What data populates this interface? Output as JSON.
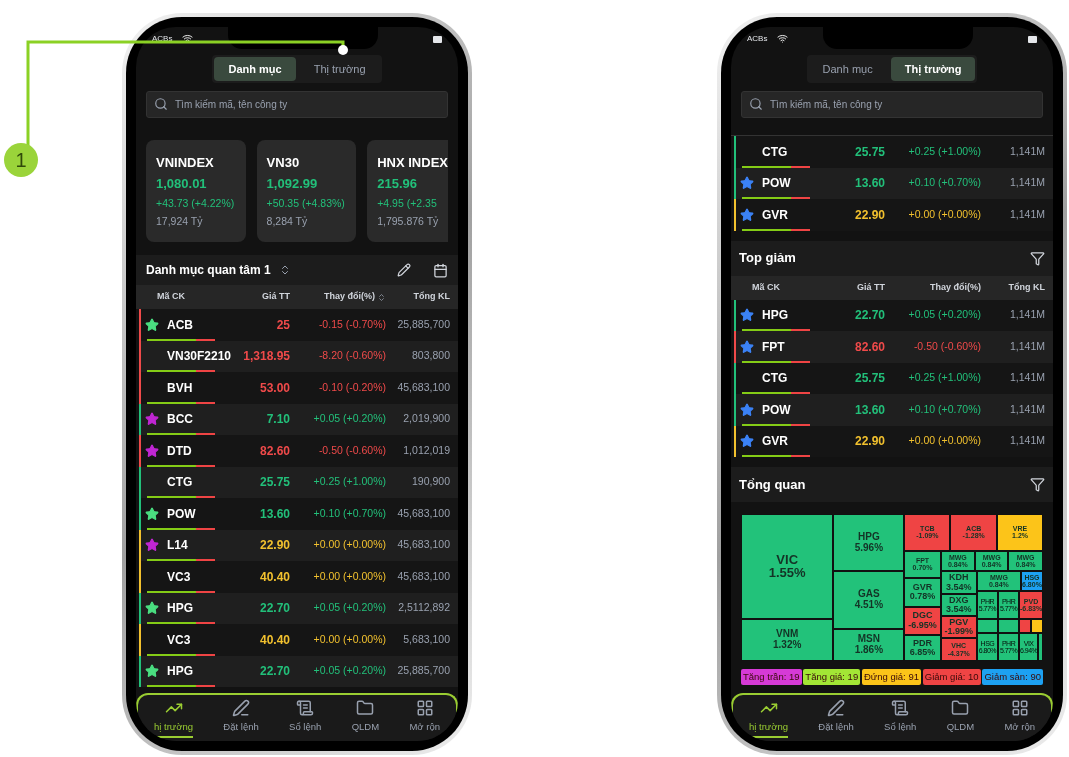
{
  "callout": {
    "label": "1"
  },
  "phones": [
    {
      "kind": "watchlist",
      "status": {
        "carrier": "ACBs"
      },
      "tabs": [
        {
          "label": "Danh mục",
          "selected": true
        },
        {
          "label": "Thị trường",
          "selected": false
        }
      ],
      "search": {
        "placeholder": "Tìm kiếm mã, tên công ty"
      },
      "index_cards": [
        {
          "name": "VNINDEX",
          "value": "1,080.01",
          "change": "+43.73 (+4.22%)",
          "turnover": "17,924 Tỷ",
          "color": "#22c07a"
        },
        {
          "name": "VN30",
          "value": "1,092.99",
          "change": "+50.35 (+4.83%)",
          "turnover": "8,284 Tỷ",
          "color": "#22c07a"
        },
        {
          "name": "HNX INDEX",
          "value": "215.96",
          "change": "+4.95 (+2.35",
          "turnover": "1,795.876 Tỷ",
          "color": "#22c07a"
        }
      ],
      "watchlist": {
        "title": "Danh mục quan tâm 1",
        "columns": [
          {
            "label": "Mã CK",
            "sortable": false
          },
          {
            "label": "Giá TT",
            "sortable": false
          },
          {
            "label": "Thay đổi(%)",
            "sortable": true
          },
          {
            "label": "Tổng KL",
            "sortable": false
          }
        ],
        "rows": [
          {
            "symbol": "ACB",
            "price": "25",
            "change": "-0.15 (-0.70%)",
            "volume": "25,885,700",
            "color": "#f04a4a",
            "star": {
              "color": "#4ade80"
            }
          },
          {
            "symbol": "VN30F2210",
            "price": "1,318.95",
            "change": "-8.20 (-0.60%)",
            "volume": "803,800",
            "color": "#f04a4a"
          },
          {
            "symbol": "BVH",
            "price": "53.00",
            "change": "-0.10 (-0.20%)",
            "volume": "45,683,100",
            "color": "#f04a4a"
          },
          {
            "symbol": "BCC",
            "price": "7.10",
            "change": "+0.05 (+0.20%)",
            "volume": "2,019,900",
            "color": "#22c07a",
            "star": {
              "color": "#c026d3"
            }
          },
          {
            "symbol": "DTD",
            "price": "82.60",
            "change": "-0.50 (-0.60%)",
            "volume": "1,012,019",
            "color": "#f04a4a",
            "star": {
              "color": "#c026d3"
            }
          },
          {
            "symbol": "CTG",
            "price": "25.75",
            "change": "+0.25 (+1.00%)",
            "volume": "190,900",
            "color": "#22c07a"
          },
          {
            "symbol": "POW",
            "price": "13.60",
            "change": "+0.10 (+0.70%)",
            "volume": "45,683,100",
            "color": "#22c07a",
            "star": {
              "color": "#4ade80"
            }
          },
          {
            "symbol": "L14",
            "price": "22.90",
            "change": "+0.00 (+0.00%)",
            "volume": "45,683,100",
            "color": "#f2c12e",
            "star": {
              "color": "#c026d3"
            }
          },
          {
            "symbol": "VC3",
            "price": "40.40",
            "change": "+0.00 (+0.00%)",
            "volume": "45,683,100",
            "color": "#f2c12e"
          },
          {
            "symbol": "HPG",
            "price": "22.70",
            "change": "+0.05 (+0.20%)",
            "volume": "2,5112,892",
            "color": "#22c07a",
            "star": {
              "color": "#4ade80"
            }
          },
          {
            "symbol": "VC3",
            "price": "40.40",
            "change": "+0.00 (+0.00%)",
            "volume": "5,683,100",
            "color": "#f2c12e"
          },
          {
            "symbol": "HPG",
            "price": "22.70",
            "change": "+0.05 (+0.20%)",
            "volume": "25,885,700",
            "color": "#22c07a",
            "star": {
              "color": "#4ade80"
            }
          }
        ]
      },
      "nav": [
        {
          "label": "hị trường",
          "selected": true
        },
        {
          "label": "Đặt lệnh",
          "selected": false
        },
        {
          "label": "Sổ lệnh",
          "selected": false
        },
        {
          "label": "QLDM",
          "selected": false
        },
        {
          "label": "Mở rộn",
          "selected": false
        }
      ]
    },
    {
      "kind": "market",
      "status": {
        "carrier": "ACBs"
      },
      "tabs": [
        {
          "label": "Danh mục",
          "selected": false
        },
        {
          "label": "Thị trường",
          "selected": true
        }
      ],
      "search": {
        "placeholder": "Tìm kiếm mã, tên công ty"
      },
      "top_rows": [
        {
          "symbol": "CTG",
          "price": "25.75",
          "change": "+0.25 (+1.00%)",
          "volume": "1,141M",
          "color": "#22c07a"
        },
        {
          "symbol": "POW",
          "price": "13.60",
          "change": "+0.10 (+0.70%)",
          "volume": "1,141M",
          "color": "#22c07a",
          "star": {
            "color": "#3b82f6"
          }
        },
        {
          "symbol": "GVR",
          "price": "22.90",
          "change": "+0.00 (+0.00%)",
          "volume": "1,141M",
          "color": "#f2c12e",
          "star": {
            "color": "#3b82f6"
          }
        }
      ],
      "section": {
        "title": "Top giảm",
        "columns": [
          {
            "label": "Mã CK"
          },
          {
            "label": "Giá TT"
          },
          {
            "label": "Thay đổi(%)"
          },
          {
            "label": "Tổng KL"
          }
        ],
        "rows": [
          {
            "symbol": "HPG",
            "price": "22.70",
            "change": "+0.05 (+0.20%)",
            "volume": "1,141M",
            "color": "#22c07a",
            "star": {
              "color": "#3b82f6"
            }
          },
          {
            "symbol": "FPT",
            "price": "82.60",
            "change": "-0.50 (-0.60%)",
            "volume": "1,141M",
            "color": "#f04a4a",
            "star": {
              "color": "#3b82f6"
            }
          },
          {
            "symbol": "CTG",
            "price": "25.75",
            "change": "+0.25 (+1.00%)",
            "volume": "1,141M",
            "color": "#22c07a"
          },
          {
            "symbol": "POW",
            "price": "13.60",
            "change": "+0.10 (+0.70%)",
            "volume": "1,141M",
            "color": "#22c07a",
            "star": {
              "color": "#3b82f6"
            }
          },
          {
            "symbol": "GVR",
            "price": "22.90",
            "change": "+0.00 (+0.00%)",
            "volume": "1,141M",
            "color": "#f2c12e",
            "star": {
              "color": "#3b82f6"
            }
          }
        ]
      },
      "overview": {
        "title": "Tổng quan",
        "treemap": [
          {
            "label": "VIC",
            "value": "1.55%",
            "color": "#22c27a"
          },
          {
            "label": "VNM",
            "value": "1.32%",
            "color": "#22c27a"
          },
          {
            "label": "HPG",
            "value": "5.96%",
            "color": "#22c27a"
          },
          {
            "label": "GAS",
            "value": "4.51%",
            "color": "#22c27a"
          },
          {
            "label": "MSN",
            "value": "1.86%",
            "color": "#22c27a"
          },
          {
            "label": "TCB",
            "value": "-1.09%",
            "color": "#ef4444"
          },
          {
            "label": "ACB",
            "value": "-1.28%",
            "color": "#ef4444"
          },
          {
            "label": "VRE",
            "value": "1.2%",
            "color": "#fcc419"
          },
          {
            "label": "FPT",
            "value": "0.70%",
            "color": "#22c27a"
          },
          {
            "label": "MWG",
            "value": "0.84%",
            "color": "#22c27a"
          },
          {
            "label": "MWG",
            "value": "0.84%",
            "color": "#22c27a"
          },
          {
            "label": "MWG",
            "value": "0.84%",
            "color": "#22c27a"
          },
          {
            "label": "GVR",
            "value": "0.78%",
            "color": "#22c27a"
          },
          {
            "label": "DGC",
            "value": "-6.95%",
            "color": "#ef4444"
          },
          {
            "label": "PDR",
            "value": "6.85%",
            "color": "#22c27a"
          },
          {
            "label": "KDH",
            "value": "3.54%",
            "color": "#22c27a"
          },
          {
            "label": "DXG",
            "value": "3.54%",
            "color": "#22c27a"
          },
          {
            "label": "PGV",
            "value": "-1.99%",
            "color": "#ef4444"
          },
          {
            "label": "VHC",
            "value": "-4.37%",
            "color": "#ef4444"
          },
          {
            "label": "MWG",
            "value": "0.84%",
            "color": "#22c27a"
          },
          {
            "label": "HSG",
            "value": "6.80%",
            "color": "#1da1f2"
          },
          {
            "label": "PHR",
            "value": "5.77%",
            "color": "#22c27a"
          },
          {
            "label": "PHR",
            "value": "5.77%",
            "color": "#22c27a"
          },
          {
            "label": "PVD",
            "value": "-6.83%",
            "color": "#ef4444"
          },
          {
            "color": "#22c27a"
          },
          {
            "color": "#22c27a"
          },
          {
            "color": "#ef4444"
          },
          {
            "color": "#fcc419"
          },
          {
            "label": "HSG",
            "value": "6.80%",
            "color": "#22c27a"
          },
          {
            "label": "PHR",
            "value": "5.77%",
            "color": "#22c27a"
          },
          {
            "label": "VIX",
            "value": "6.94%",
            "color": "#22c27a"
          },
          {
            "color": "#22c27a"
          }
        ],
        "legend": [
          {
            "label": "Tăng trần: 19",
            "color": "#d63ad6"
          },
          {
            "label": "Tăng giá: 19",
            "color": "#a3e635"
          },
          {
            "label": "Đứng giá: 91",
            "color": "#fcc419"
          },
          {
            "label": "Giảm giá: 10",
            "color": "#ef4444"
          },
          {
            "label": "Giảm sàn: 90",
            "color": "#1da1f2"
          }
        ]
      },
      "nav": [
        {
          "label": "hị trường",
          "selected": true
        },
        {
          "label": "Đặt lệnh",
          "selected": false
        },
        {
          "label": "Sổ lệnh",
          "selected": false
        },
        {
          "label": "QLDM",
          "selected": false
        },
        {
          "label": "Mở rộn",
          "selected": false
        }
      ]
    }
  ]
}
